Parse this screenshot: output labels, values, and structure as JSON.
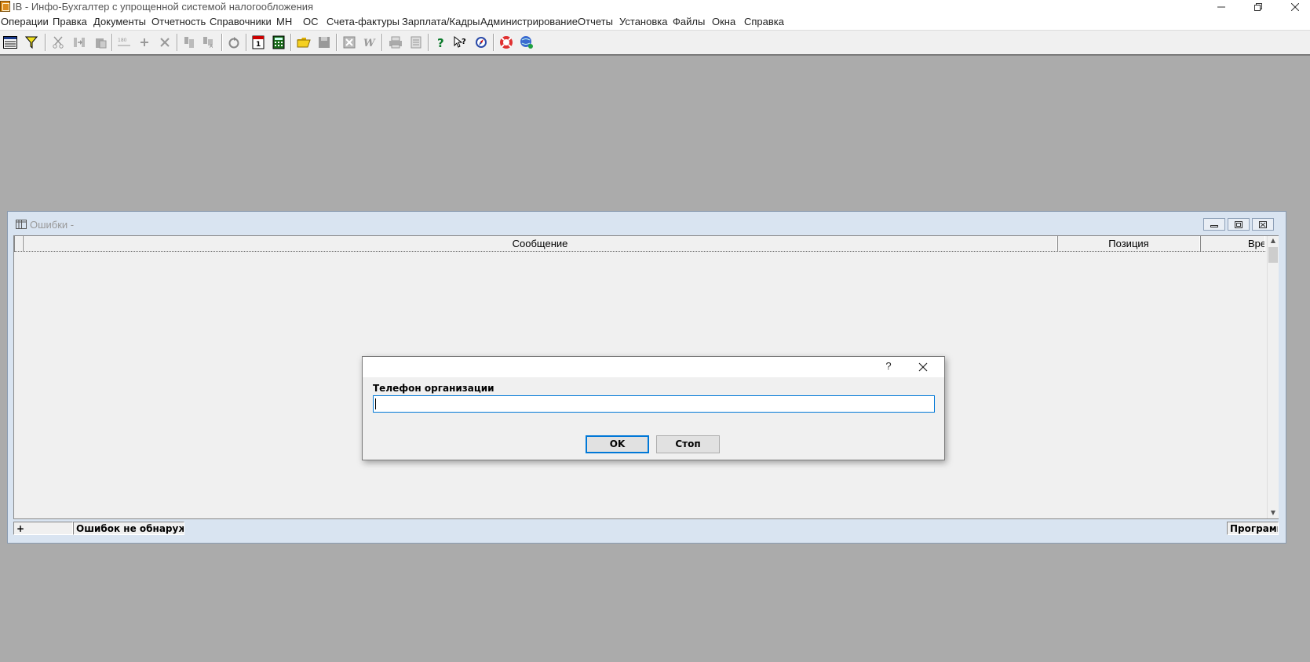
{
  "app": {
    "title": "IB - Инфо-Бухгалтер с упрощенной системой налогообложения"
  },
  "menu": {
    "items": [
      {
        "label": "Операции"
      },
      {
        "label": "Правка"
      },
      {
        "label": "Документы"
      },
      {
        "label": "Отчетность"
      },
      {
        "label": "Справочники"
      },
      {
        "label": "МН"
      },
      {
        "label": "ОС"
      },
      {
        "label": "Счета-фактуры"
      },
      {
        "label": "Зарплата/Кадры"
      },
      {
        "label": "Администрирование"
      },
      {
        "label": "Отчеты"
      },
      {
        "label": "Установка"
      },
      {
        "label": "Файлы"
      },
      {
        "label": "Окна"
      },
      {
        "label": "Справка"
      }
    ]
  },
  "toolbar": {
    "icons": [
      "grid-view-icon",
      "filter-icon",
      "cut-icon",
      "transfer-icon",
      "paste-icon",
      "number-sort-icon",
      "add-icon",
      "delete-icon",
      "find-icon",
      "replace-icon",
      "refresh-icon",
      "calendar-icon",
      "calculator-icon",
      "open-folder-icon",
      "save-icon",
      "export-icon",
      "word-icon",
      "print-icon",
      "preview-icon",
      "help-icon",
      "context-help-icon",
      "navigator-icon",
      "support-icon",
      "web-icon"
    ],
    "number_sort_icon_text": "180"
  },
  "errors_window": {
    "title": "Ошибки -",
    "columns": {
      "message": "Сообщение",
      "position": "Позиция",
      "time": "Время"
    },
    "status": {
      "expand": "+",
      "message": "Ошибок не обнаружено",
      "source": "Программа"
    }
  },
  "dialog": {
    "help_label": "?",
    "field_label": "Телефон организации",
    "field_value": "",
    "ok_label": "OK",
    "stop_label": "Стоп"
  },
  "colors": {
    "desktop": "#ababab",
    "focus": "#0078d7"
  }
}
